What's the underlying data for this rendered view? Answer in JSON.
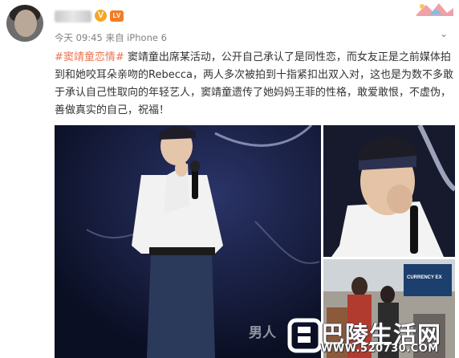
{
  "post": {
    "author_name": "",
    "timestamp": "今天 09:45",
    "source": "来自 iPhone 6",
    "hashtag": "#窦靖童恋情#",
    "body": " 窦靖童出席某活动，公开自己承认了是同性恋，而女友正是之前媒体拍到和她咬耳朵亲吻的Rebecca，两人多次被拍到十指紧扣出双入对，这也是为数不多敢于承认自己性取向的年轻艺人，窦靖童遗传了她妈妈王菲的性格，敢爱敢恨，不虚伪，善做真实的自己，祝福！"
  },
  "badges": {
    "verified": "V",
    "level": "LV"
  },
  "photos": [
    {
      "name": "main-photo"
    },
    {
      "name": "closeup-photo"
    },
    {
      "name": "street-photo",
      "sign_text": "CURRENCY EX"
    }
  ],
  "photo1_watermark": "男人",
  "watermark": {
    "site_name": "巴陵生活网",
    "url": "WWW.520730.COM"
  },
  "icons": [
    "avatar",
    "verified-icon",
    "level-icon",
    "header-decoration-icon",
    "chevron-down-icon",
    "watermark-logo-icon"
  ],
  "colors": {
    "hashtag": "#eb7350",
    "meta": "#808080",
    "verified": "#f6a623"
  }
}
